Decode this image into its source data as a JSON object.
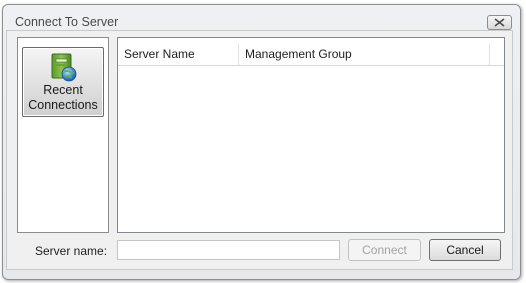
{
  "window": {
    "title": "Connect To Server",
    "close_icon": "close-icon"
  },
  "nav": {
    "items": [
      {
        "label": "Recent\nConnections",
        "icon": "server-globe-icon",
        "selected": true
      }
    ]
  },
  "list": {
    "columns": [
      "Server Name",
      "Management Group"
    ],
    "rows": []
  },
  "form": {
    "server_name_label": "Server name:",
    "server_name_value": ""
  },
  "buttons": {
    "connect_label": "Connect",
    "connect_enabled": false,
    "cancel_label": "Cancel"
  }
}
